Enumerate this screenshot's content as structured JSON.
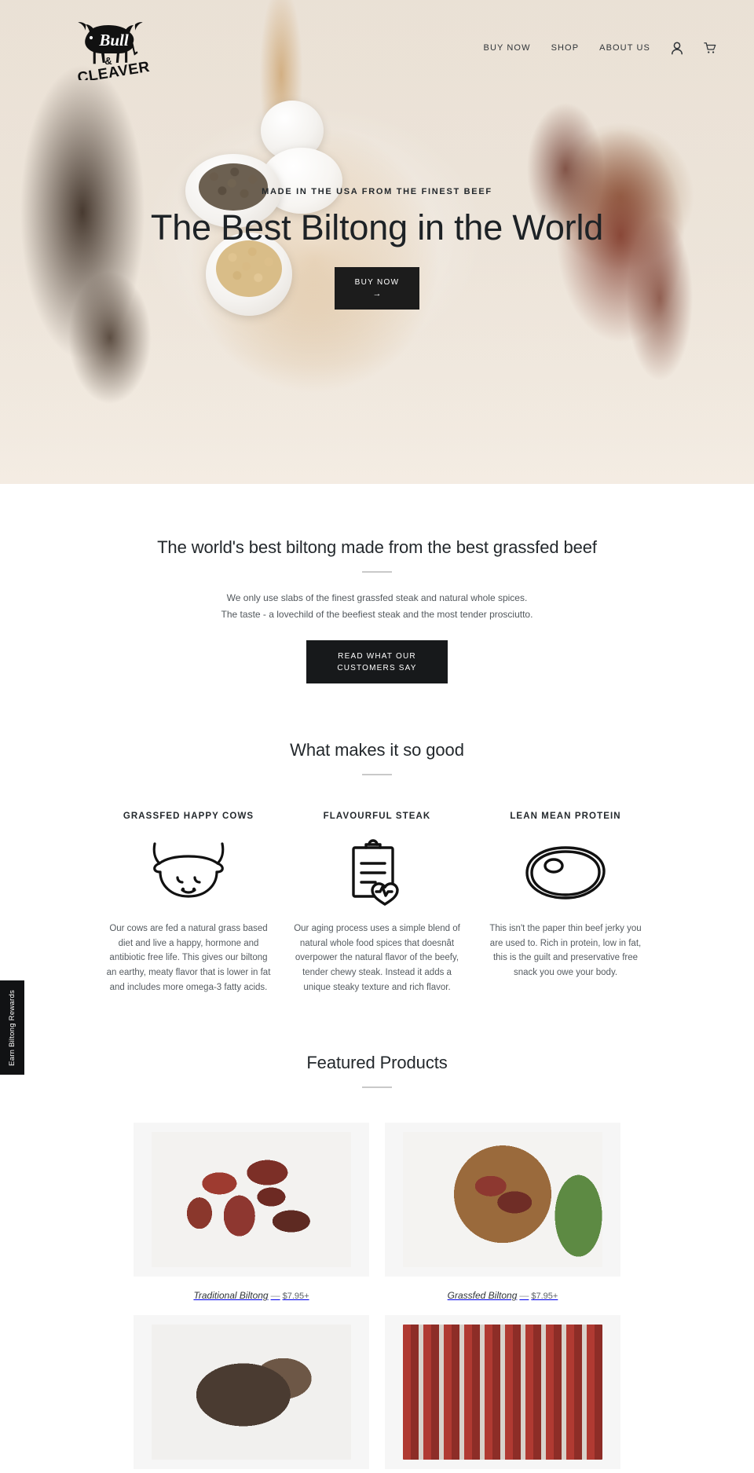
{
  "site": {
    "brand_name": "Bull & Cleaver",
    "logo_word_top": "Bull",
    "logo_amp": "&",
    "logo_word_bottom": "CLEAVER"
  },
  "nav": {
    "links": [
      {
        "label": "BUY NOW"
      },
      {
        "label": "SHOP"
      },
      {
        "label": "ABOUT US"
      }
    ],
    "account_icon": "user-account-icon",
    "cart_icon": "shopping-cart-icon"
  },
  "hero": {
    "eyebrow": "MADE IN THE USA FROM THE FINEST BEEF",
    "title": "The Best Biltong in the World",
    "cta_label": "BUY NOW",
    "cta_arrow": "→"
  },
  "intro": {
    "heading": "The world's best biltong made from the best grassfed beef",
    "line1": "We only use slabs of the finest grassfed steak and natural whole spices.",
    "line2": "The taste - a lovechild of the beefiest steak and the most tender prosciutto.",
    "cta_label": "READ WHAT OUR CUSTOMERS SAY"
  },
  "what_makes_it_good": {
    "heading": "What makes it so good",
    "features": [
      {
        "title": "GRASSFED HAPPY COWS",
        "icon": "bull-head-icon",
        "text": "Our cows are fed a natural grass based diet and live a happy, hormone and antibiotic free life. This gives our biltong an earthy, meaty flavor that is lower in fat and includes more omega-3 fatty acids."
      },
      {
        "title": "FLAVOURFUL STEAK",
        "icon": "clipboard-heart-icon",
        "text": "Our aging process uses a simple blend of natural whole food spices that doesnât overpower the natural flavor of the beefy, tender chewy steak. Instead it adds a unique steaky texture and rich flavor."
      },
      {
        "title": "LEAN MEAN PROTEIN",
        "icon": "steak-cut-icon",
        "text": "This isn't the paper thin beef jerky you are used to. Rich in protein, low in fat, this is the guilt and preservative free snack you owe your body."
      }
    ]
  },
  "featured_products": {
    "heading": "Featured Products",
    "dash": "—",
    "products": [
      {
        "name": "Traditional Biltong",
        "price": "$7.95+",
        "photo": "photo-a"
      },
      {
        "name": "Grassfed Biltong",
        "price": "$7.95+",
        "photo": "photo-b"
      },
      {
        "name": "",
        "price": "",
        "photo": "photo-c"
      },
      {
        "name": "",
        "price": "",
        "photo": "photo-d"
      }
    ]
  },
  "rewards_tab": {
    "label": "Earn Biltong Rewards"
  },
  "colors": {
    "text_dark": "#23282c",
    "text_body": "#555b60",
    "button_dark": "#17191b",
    "rule": "#c9c9c9",
    "thumb_bg": "#f6f6f6"
  }
}
